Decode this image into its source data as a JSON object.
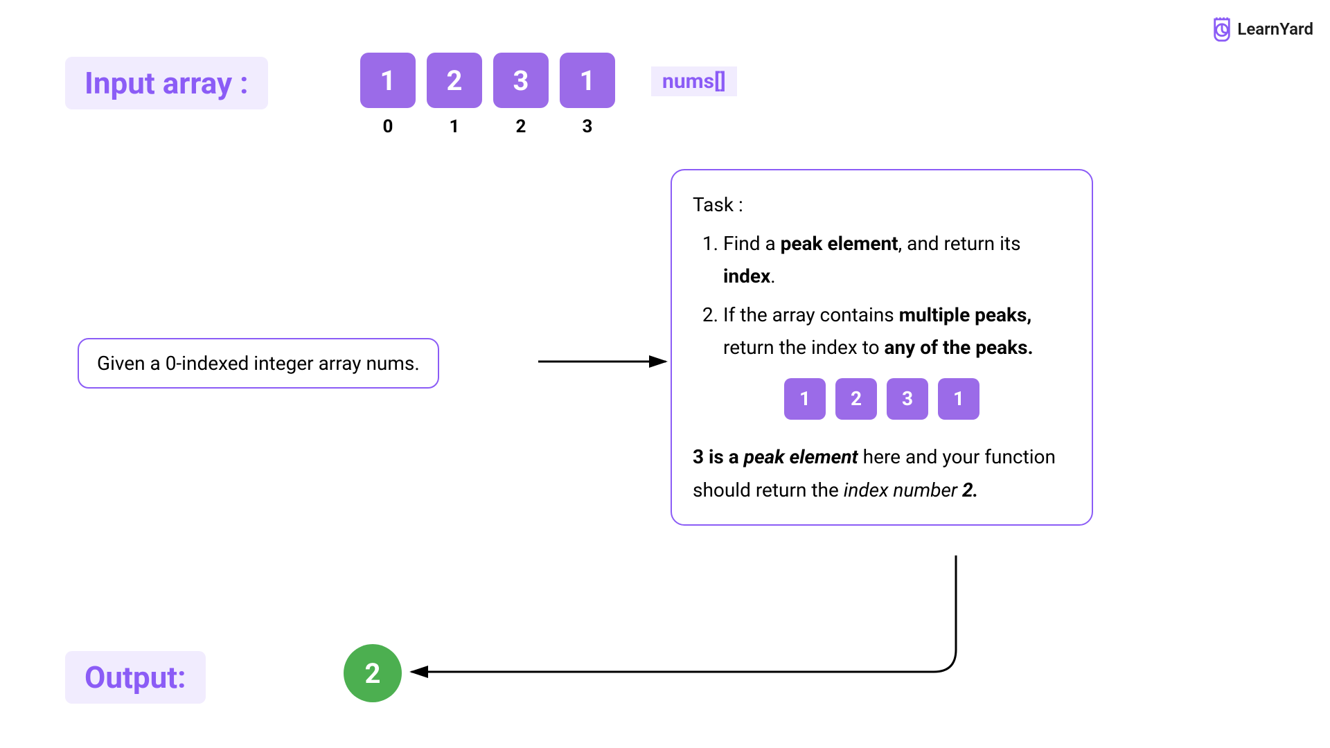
{
  "logo": {
    "text": "LearnYard"
  },
  "input": {
    "label": "Input array :",
    "values": [
      "1",
      "2",
      "3",
      "1"
    ],
    "indices": [
      "0",
      "1",
      "2",
      "3"
    ],
    "nums_label": "nums[]"
  },
  "given": {
    "text": "Given a 0-indexed integer array nums."
  },
  "task": {
    "title": "Task :",
    "item1_prefix": "Find a ",
    "item1_bold1": "peak element",
    "item1_mid": ", and return its ",
    "item1_bold2": "index",
    "item1_suffix": ".",
    "item2_prefix": "If the array contains ",
    "item2_bold1": "multiple peaks,",
    "item2_mid": " return the index to ",
    "item2_bold2": "any of the peaks.",
    "array": [
      "1",
      "2",
      "3",
      "1"
    ],
    "explain_bold1": "3 is a ",
    "explain_bolditalic": "peak element",
    "explain_mid1": " here and your function should return the ",
    "explain_italic": "index number ",
    "explain_bolditalic2": "2."
  },
  "output": {
    "label": "Output:",
    "value": "2"
  }
}
